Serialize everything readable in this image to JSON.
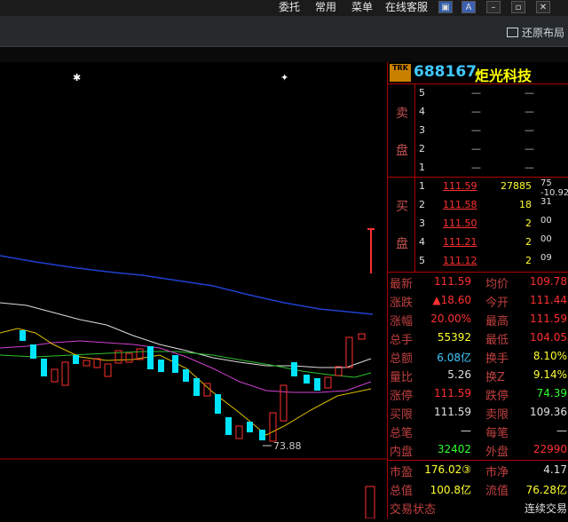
{
  "menu": [
    "委托",
    "常用",
    "菜单",
    "在线客服"
  ],
  "toolbar": {
    "restore_label": "还原布局"
  },
  "stock": {
    "badge": "TRK",
    "code": "688167",
    "name": "炬光科技"
  },
  "chart": {
    "low_label": "73.88"
  },
  "sell": {
    "side_chars": [
      "卖",
      "盘"
    ],
    "levels": [
      {
        "level": "5",
        "price": "—",
        "vol": "—"
      },
      {
        "level": "4",
        "price": "—",
        "vol": "—"
      },
      {
        "level": "3",
        "price": "—",
        "vol": "—"
      },
      {
        "level": "2",
        "price": "—",
        "vol": "—"
      },
      {
        "level": "1",
        "price": "—",
        "vol": "—"
      }
    ]
  },
  "buy": {
    "side_chars": [
      "买",
      "盘"
    ],
    "levels": [
      {
        "level": "1",
        "price": "111.59",
        "vol": "27885",
        "extra": "75  -10.92"
      },
      {
        "level": "2",
        "price": "111.58",
        "vol": "18",
        "extra": "31"
      },
      {
        "level": "3",
        "price": "111.50",
        "vol": "2",
        "extra": "00"
      },
      {
        "level": "4",
        "price": "111.21",
        "vol": "2",
        "extra": "00"
      },
      {
        "level": "5",
        "price": "111.12",
        "vol": "2",
        "extra": "09"
      }
    ]
  },
  "quote": [
    {
      "l1": "最新",
      "v1": "111.59",
      "c1": "#ff3030",
      "l2": "均价",
      "v2": "109.78",
      "c2": "#ff3030"
    },
    {
      "l1": "涨跌",
      "v1": "▲18.60",
      "c1": "#ff3030",
      "l2": "今开",
      "v2": "111.44",
      "c2": "#ff3030"
    },
    {
      "l1": "涨幅",
      "v1": "20.00%",
      "c1": "#ff3030",
      "l2": "最高",
      "v2": "111.59",
      "c2": "#ff3030"
    },
    {
      "l1": "总手",
      "v1": "55392",
      "c1": "#ffff30",
      "l2": "最低",
      "v2": "104.05",
      "c2": "#ff3030"
    },
    {
      "l1": "总额",
      "v1": "6.08亿",
      "c1": "#40c8ff",
      "l2": "换手",
      "v2": "8.10%",
      "c2": "#ffff30"
    },
    {
      "l1": "量比",
      "v1": "5.26",
      "c1": "#e0e0e0",
      "l2": "换Z",
      "v2": "9.14%",
      "c2": "#ffff30"
    },
    {
      "l1": "涨停",
      "v1": "111.59",
      "c1": "#ff3030",
      "l2": "跌停",
      "v2": "74.39",
      "c2": "#30ff30"
    },
    {
      "l1": "买限",
      "v1": "111.59",
      "c1": "#e0e0e0",
      "l2": "卖限",
      "v2": "109.36",
      "c2": "#e0e0e0"
    },
    {
      "l1": "总笔",
      "v1": "—",
      "c1": "#e0e0e0",
      "l2": "每笔",
      "v2": "—",
      "c2": "#e0e0e0"
    },
    {
      "l1": "内盘",
      "v1": "32402",
      "c1": "#30ff30",
      "l2": "外盘",
      "v2": "22990",
      "c2": "#ff3030"
    }
  ],
  "bottom": [
    {
      "l1": "市盈",
      "v1": "176.02③",
      "c1": "#ffff30",
      "l2": "市净",
      "v2": "4.17",
      "c2": "#e0e0e0"
    },
    {
      "l1": "总值",
      "v1": "100.8亿",
      "c1": "#ffff30",
      "l2": "流值",
      "v2": "76.28亿",
      "c2": "#ffff30"
    },
    {
      "l1": "交易状态",
      "v1": "",
      "c1": "#e0e0e0",
      "l2": "",
      "v2": "连续交易",
      "c2": "#e0e0e0"
    }
  ]
}
